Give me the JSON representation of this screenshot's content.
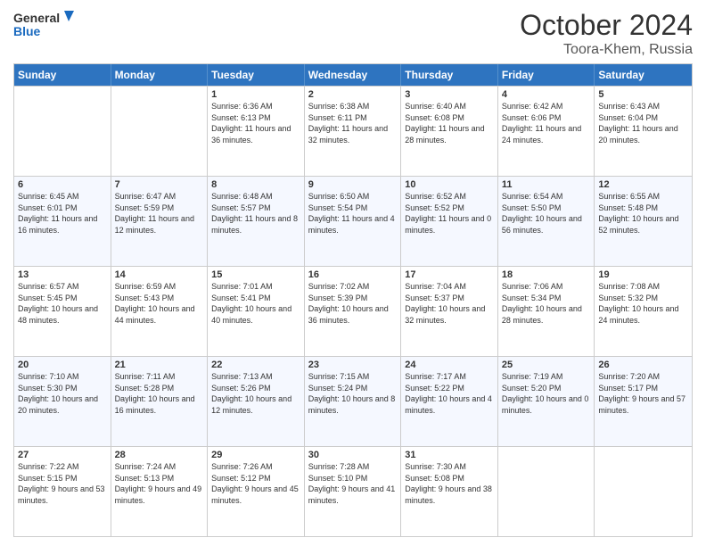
{
  "logo": {
    "general": "General",
    "blue": "Blue"
  },
  "header": {
    "month": "October 2024",
    "location": "Toora-Khem, Russia"
  },
  "weekdays": [
    "Sunday",
    "Monday",
    "Tuesday",
    "Wednesday",
    "Thursday",
    "Friday",
    "Saturday"
  ],
  "rows": [
    [
      {
        "day": "",
        "sunrise": "",
        "sunset": "",
        "daylight": ""
      },
      {
        "day": "",
        "sunrise": "",
        "sunset": "",
        "daylight": ""
      },
      {
        "day": "1",
        "sunrise": "Sunrise: 6:36 AM",
        "sunset": "Sunset: 6:13 PM",
        "daylight": "Daylight: 11 hours and 36 minutes."
      },
      {
        "day": "2",
        "sunrise": "Sunrise: 6:38 AM",
        "sunset": "Sunset: 6:11 PM",
        "daylight": "Daylight: 11 hours and 32 minutes."
      },
      {
        "day": "3",
        "sunrise": "Sunrise: 6:40 AM",
        "sunset": "Sunset: 6:08 PM",
        "daylight": "Daylight: 11 hours and 28 minutes."
      },
      {
        "day": "4",
        "sunrise": "Sunrise: 6:42 AM",
        "sunset": "Sunset: 6:06 PM",
        "daylight": "Daylight: 11 hours and 24 minutes."
      },
      {
        "day": "5",
        "sunrise": "Sunrise: 6:43 AM",
        "sunset": "Sunset: 6:04 PM",
        "daylight": "Daylight: 11 hours and 20 minutes."
      }
    ],
    [
      {
        "day": "6",
        "sunrise": "Sunrise: 6:45 AM",
        "sunset": "Sunset: 6:01 PM",
        "daylight": "Daylight: 11 hours and 16 minutes."
      },
      {
        "day": "7",
        "sunrise": "Sunrise: 6:47 AM",
        "sunset": "Sunset: 5:59 PM",
        "daylight": "Daylight: 11 hours and 12 minutes."
      },
      {
        "day": "8",
        "sunrise": "Sunrise: 6:48 AM",
        "sunset": "Sunset: 5:57 PM",
        "daylight": "Daylight: 11 hours and 8 minutes."
      },
      {
        "day": "9",
        "sunrise": "Sunrise: 6:50 AM",
        "sunset": "Sunset: 5:54 PM",
        "daylight": "Daylight: 11 hours and 4 minutes."
      },
      {
        "day": "10",
        "sunrise": "Sunrise: 6:52 AM",
        "sunset": "Sunset: 5:52 PM",
        "daylight": "Daylight: 11 hours and 0 minutes."
      },
      {
        "day": "11",
        "sunrise": "Sunrise: 6:54 AM",
        "sunset": "Sunset: 5:50 PM",
        "daylight": "Daylight: 10 hours and 56 minutes."
      },
      {
        "day": "12",
        "sunrise": "Sunrise: 6:55 AM",
        "sunset": "Sunset: 5:48 PM",
        "daylight": "Daylight: 10 hours and 52 minutes."
      }
    ],
    [
      {
        "day": "13",
        "sunrise": "Sunrise: 6:57 AM",
        "sunset": "Sunset: 5:45 PM",
        "daylight": "Daylight: 10 hours and 48 minutes."
      },
      {
        "day": "14",
        "sunrise": "Sunrise: 6:59 AM",
        "sunset": "Sunset: 5:43 PM",
        "daylight": "Daylight: 10 hours and 44 minutes."
      },
      {
        "day": "15",
        "sunrise": "Sunrise: 7:01 AM",
        "sunset": "Sunset: 5:41 PM",
        "daylight": "Daylight: 10 hours and 40 minutes."
      },
      {
        "day": "16",
        "sunrise": "Sunrise: 7:02 AM",
        "sunset": "Sunset: 5:39 PM",
        "daylight": "Daylight: 10 hours and 36 minutes."
      },
      {
        "day": "17",
        "sunrise": "Sunrise: 7:04 AM",
        "sunset": "Sunset: 5:37 PM",
        "daylight": "Daylight: 10 hours and 32 minutes."
      },
      {
        "day": "18",
        "sunrise": "Sunrise: 7:06 AM",
        "sunset": "Sunset: 5:34 PM",
        "daylight": "Daylight: 10 hours and 28 minutes."
      },
      {
        "day": "19",
        "sunrise": "Sunrise: 7:08 AM",
        "sunset": "Sunset: 5:32 PM",
        "daylight": "Daylight: 10 hours and 24 minutes."
      }
    ],
    [
      {
        "day": "20",
        "sunrise": "Sunrise: 7:10 AM",
        "sunset": "Sunset: 5:30 PM",
        "daylight": "Daylight: 10 hours and 20 minutes."
      },
      {
        "day": "21",
        "sunrise": "Sunrise: 7:11 AM",
        "sunset": "Sunset: 5:28 PM",
        "daylight": "Daylight: 10 hours and 16 minutes."
      },
      {
        "day": "22",
        "sunrise": "Sunrise: 7:13 AM",
        "sunset": "Sunset: 5:26 PM",
        "daylight": "Daylight: 10 hours and 12 minutes."
      },
      {
        "day": "23",
        "sunrise": "Sunrise: 7:15 AM",
        "sunset": "Sunset: 5:24 PM",
        "daylight": "Daylight: 10 hours and 8 minutes."
      },
      {
        "day": "24",
        "sunrise": "Sunrise: 7:17 AM",
        "sunset": "Sunset: 5:22 PM",
        "daylight": "Daylight: 10 hours and 4 minutes."
      },
      {
        "day": "25",
        "sunrise": "Sunrise: 7:19 AM",
        "sunset": "Sunset: 5:20 PM",
        "daylight": "Daylight: 10 hours and 0 minutes."
      },
      {
        "day": "26",
        "sunrise": "Sunrise: 7:20 AM",
        "sunset": "Sunset: 5:17 PM",
        "daylight": "Daylight: 9 hours and 57 minutes."
      }
    ],
    [
      {
        "day": "27",
        "sunrise": "Sunrise: 7:22 AM",
        "sunset": "Sunset: 5:15 PM",
        "daylight": "Daylight: 9 hours and 53 minutes."
      },
      {
        "day": "28",
        "sunrise": "Sunrise: 7:24 AM",
        "sunset": "Sunset: 5:13 PM",
        "daylight": "Daylight: 9 hours and 49 minutes."
      },
      {
        "day": "29",
        "sunrise": "Sunrise: 7:26 AM",
        "sunset": "Sunset: 5:12 PM",
        "daylight": "Daylight: 9 hours and 45 minutes."
      },
      {
        "day": "30",
        "sunrise": "Sunrise: 7:28 AM",
        "sunset": "Sunset: 5:10 PM",
        "daylight": "Daylight: 9 hours and 41 minutes."
      },
      {
        "day": "31",
        "sunrise": "Sunrise: 7:30 AM",
        "sunset": "Sunset: 5:08 PM",
        "daylight": "Daylight: 9 hours and 38 minutes."
      },
      {
        "day": "",
        "sunrise": "",
        "sunset": "",
        "daylight": ""
      },
      {
        "day": "",
        "sunrise": "",
        "sunset": "",
        "daylight": ""
      }
    ]
  ]
}
